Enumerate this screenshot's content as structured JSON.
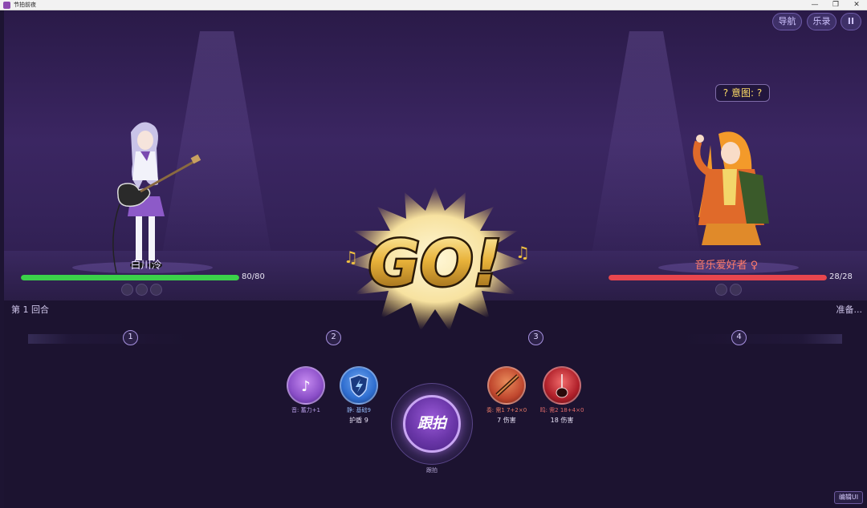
{
  "window": {
    "title": "节拍前夜"
  },
  "titlebar_controls": {
    "minimize": "—",
    "restore": "❐",
    "close": "✕"
  },
  "top_buttons": {
    "nav": "导航",
    "log": "乐录",
    "pause": "II"
  },
  "player": {
    "name": "白川泠",
    "hp_text": "80/80",
    "hp_fraction": 1.0
  },
  "enemy": {
    "name": "音乐爱好者 ♀",
    "hp_text": "28/28",
    "hp_fraction": 1.0,
    "intent": "? 意图: ?"
  },
  "splash": {
    "text": "GO!"
  },
  "battle": {
    "round_label": "第 1 回合",
    "status": "准备..."
  },
  "beats": [
    "1",
    "2",
    "3",
    "4"
  ],
  "cards": [
    {
      "id": "yin",
      "sub": "音: 蓄力+1",
      "main": "",
      "color": "#8b4fc8",
      "sub_color": "#b89ee8"
    },
    {
      "id": "jing",
      "sub": "静: 基础9",
      "main": "护盾 9",
      "color": "#2f6ed0",
      "sub_color": "#8fb3f0"
    },
    {
      "id": "zou",
      "sub": "奏: 需1 7+2×0",
      "main": "7 伤害",
      "color": "#c0472e",
      "sub_color": "#e87a66"
    },
    {
      "id": "ming",
      "sub": "鸣: 需2 18+4×0",
      "main": "18 伤害",
      "color": "#b0202a",
      "sub_color": "#e06a6a"
    }
  ],
  "beat_button": {
    "label": "跟拍",
    "caption": "跟拍"
  },
  "edit_ui": {
    "label": "编辑UI"
  },
  "colors": {
    "hp_player": "#3bd14a",
    "hp_enemy": "#e8464e",
    "accent": "#9a5ad8"
  }
}
